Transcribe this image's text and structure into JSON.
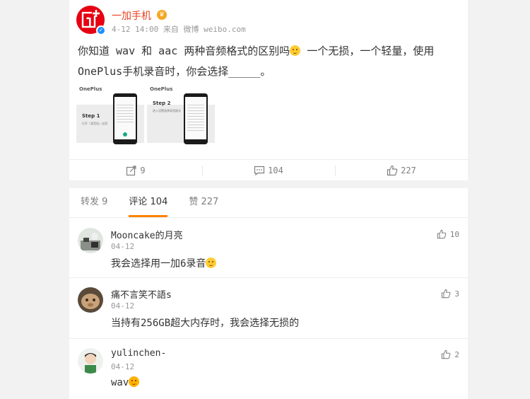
{
  "post": {
    "author": "一加手机",
    "vip_icon": "vip-crown-icon",
    "time": "4-12 14:00",
    "source_prefix": "来自",
    "source": "微博 weibo.com",
    "text_part1": "你知道 wav 和 aac 两种音频格式的区别吗",
    "text_part2": " 一个无损，一个轻量，使用OnePlus手机录音时，你会选择_____。",
    "images": [
      {
        "logo": "OnePlus",
        "step": "Step 1",
        "desc": "打开「录音机」应用"
      },
      {
        "logo": "OnePlus",
        "step": "Step 2",
        "desc": "进入设置选择录音格式"
      }
    ],
    "actions": {
      "repost_count": "9",
      "comment_count": "104",
      "like_count": "227"
    }
  },
  "tabs": {
    "repost": "转发 9",
    "comment": "评论 104",
    "like": "赞 227"
  },
  "comments": [
    {
      "name": "Mooncake的月亮",
      "date": "04-12",
      "text": "我会选择用一加6录音",
      "likes": "10"
    },
    {
      "name": "痛不言笑不語s",
      "date": "04-12",
      "text": "当持有256GB超大内存时，我会选择无损的",
      "likes": "3"
    },
    {
      "name": "yulinchen-",
      "date": "04-12",
      "text": "wav",
      "likes": "2"
    }
  ],
  "colors": {
    "accent_orange": "#ff8200",
    "brand_red": "#e60012",
    "author_red": "#e8411e"
  }
}
